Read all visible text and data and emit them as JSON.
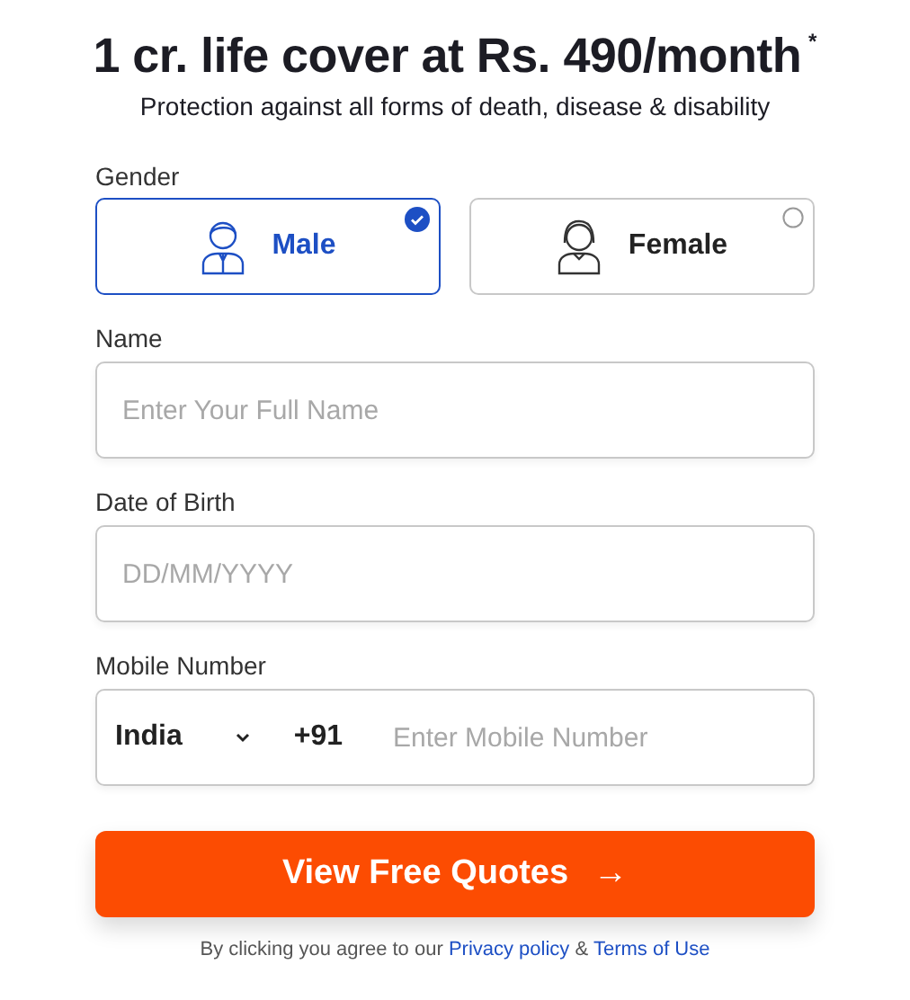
{
  "heading": {
    "title": "1 cr. life cover at Rs. 490/month",
    "mark": "*",
    "subtitle": "Protection against all forms of death, disease & disability"
  },
  "gender": {
    "label": "Gender",
    "options": [
      {
        "label": "Male",
        "kind": "male",
        "selected": true
      },
      {
        "label": "Female",
        "kind": "female",
        "selected": false
      }
    ]
  },
  "fields": [
    {
      "kind": "text",
      "label": "Name",
      "placeholder": "Enter Your Full Name"
    },
    {
      "kind": "text",
      "label": "Date of Birth",
      "placeholder": "DD/MM/YYYY"
    },
    {
      "kind": "phone",
      "label": "Mobile Number",
      "country": "India",
      "code": "+91",
      "placeholder": "Enter Mobile Number"
    }
  ],
  "submit": {
    "label": "View Free Quotes",
    "arrow": "→"
  },
  "footer": {
    "text_before": "By clicking you agree to our",
    "link_1": "Privacy policy",
    "joiner": "&",
    "link_2": "Terms of Use"
  }
}
